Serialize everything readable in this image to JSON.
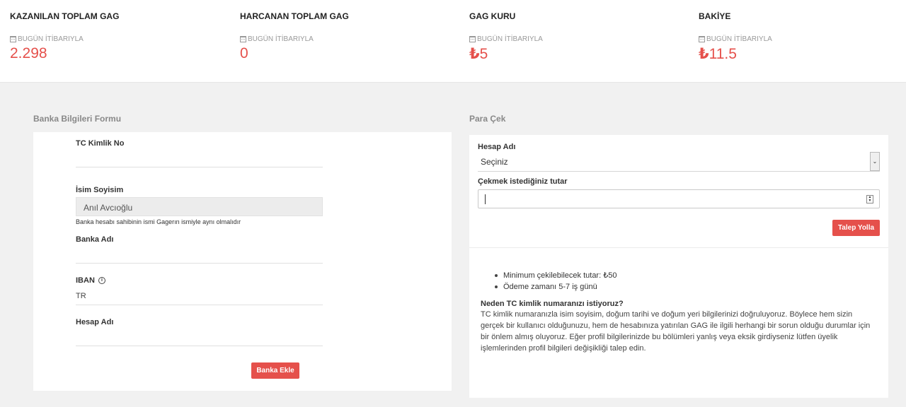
{
  "stats": [
    {
      "title": "KAZANILAN TOPLAM GAG",
      "subtitle": "BUGÜN İTİBARIYLA",
      "currency": "",
      "value": "2.298"
    },
    {
      "title": "HARCANAN TOPLAM GAG",
      "subtitle": "BUGÜN İTİBARIYLA",
      "currency": "",
      "value": "0"
    },
    {
      "title": "GAG KURU",
      "subtitle": "BUGÜN İTİBARIYLA",
      "currency": "₺",
      "value": "5"
    },
    {
      "title": "BAKİYE",
      "subtitle": "BUGÜN İTİBARIYLA",
      "currency": "₺",
      "value": "11.5"
    }
  ],
  "bank_form": {
    "section_title": "Banka Bilgileri Formu",
    "tc_label": "TC Kimlik No",
    "tc_value": "",
    "name_label": "İsim Soyisim",
    "name_value": "Anıl Avcıoğlu",
    "name_hint": "Banka hesabı sahibinin ismi Gagerın ismiyle aynı olmalıdır",
    "bank_label": "Banka Adı",
    "bank_value": "",
    "iban_label": "IBAN",
    "iban_value": "TR",
    "account_label": "Hesap Adı",
    "account_value": "",
    "submit_label": "Banka Ekle"
  },
  "withdraw": {
    "section_title": "Para Çek",
    "account_label": "Hesap Adı",
    "account_selected": "Seçiniz",
    "amount_label": "Çekmek istediğiniz tutar",
    "amount_value": "",
    "submit_label": "Talep Yolla",
    "info_items": [
      "Minimum çekilebilecek tutar: ₺50",
      "Ödeme zamanı 5-7 iş günü"
    ],
    "question_title": "Neden TC kimlik numaranızı istiyoruz?",
    "question_body": "TC kimlik numaranızla isim soyisim, doğum tarihi ve doğum yeri bilgilerinizi doğruluyoruz. Böylece hem sizin gerçek bir kullanıcı olduğunuzu, hem de hesabınıza yatırılan GAG ile ilgili herhangi bir sorun olduğu durumlar için bir önlem almış oluyoruz. Eğer profil bilgilerinizde bu bölümleri yanlış veya eksik girdiyseniz lütfen üyelik işlemlerinden profil bilgileri değişikliği talep edin."
  },
  "colors": {
    "accent": "#e5504b",
    "background": "#f1f1f1"
  }
}
